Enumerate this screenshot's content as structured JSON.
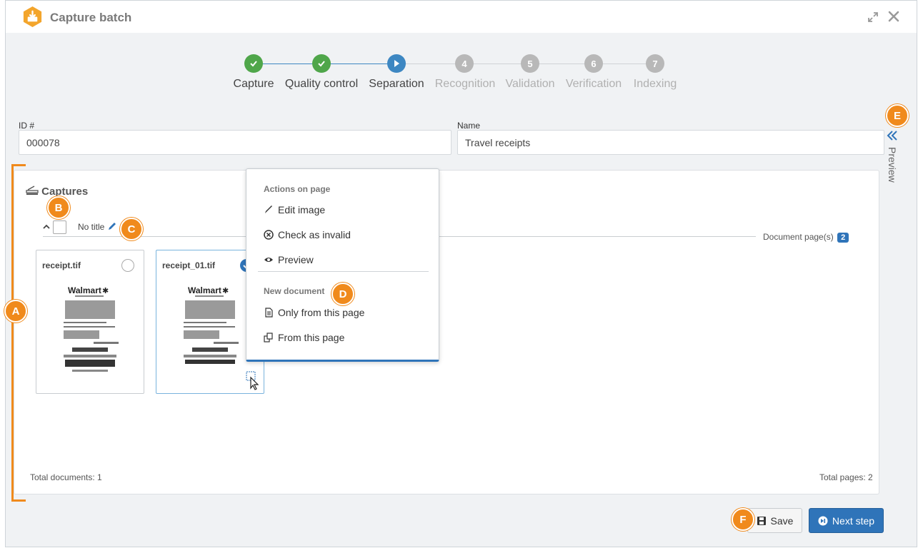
{
  "window": {
    "title": "Capture batch"
  },
  "steps": [
    {
      "label": "Capture",
      "number": "1",
      "status": "done"
    },
    {
      "label": "Quality control",
      "number": "2",
      "status": "done"
    },
    {
      "label": "Separation",
      "number": "3",
      "status": "current"
    },
    {
      "label": "Recognition",
      "number": "4",
      "status": "pending"
    },
    {
      "label": "Validation",
      "number": "5",
      "status": "pending"
    },
    {
      "label": "Verification",
      "number": "6",
      "status": "pending"
    },
    {
      "label": "Indexing",
      "number": "7",
      "status": "pending"
    }
  ],
  "form": {
    "id_label": "ID #",
    "id_value": "000078",
    "name_label": "Name",
    "name_value": "Travel receipts"
  },
  "preview_tab": {
    "label": "Preview"
  },
  "captures": {
    "title": "Captures",
    "group_title": "No title",
    "document_pages_label": "Document page(s)",
    "document_pages_count": "2",
    "cards": [
      {
        "name": "receipt.tif",
        "selected": false
      },
      {
        "name": "receipt_01.tif",
        "selected": true
      }
    ],
    "total_documents": "Total documents: 1",
    "total_pages": "Total pages: 2"
  },
  "context_menu": {
    "header_actions": "Actions on page",
    "edit_image": "Edit image",
    "check_invalid": "Check as invalid",
    "preview": "Preview",
    "header_new": "New document",
    "only_from_page": "Only from this page",
    "from_page": "From this page"
  },
  "footer": {
    "save": "Save",
    "next_step": "Next step"
  },
  "markers": {
    "a": "A",
    "b": "B",
    "c": "C",
    "d": "D",
    "e": "E",
    "f": "F"
  },
  "colors": {
    "accent": "#2f74b9",
    "done": "#4fa64a",
    "pending": "#b8b8b8",
    "marker": "#f08a1c"
  }
}
